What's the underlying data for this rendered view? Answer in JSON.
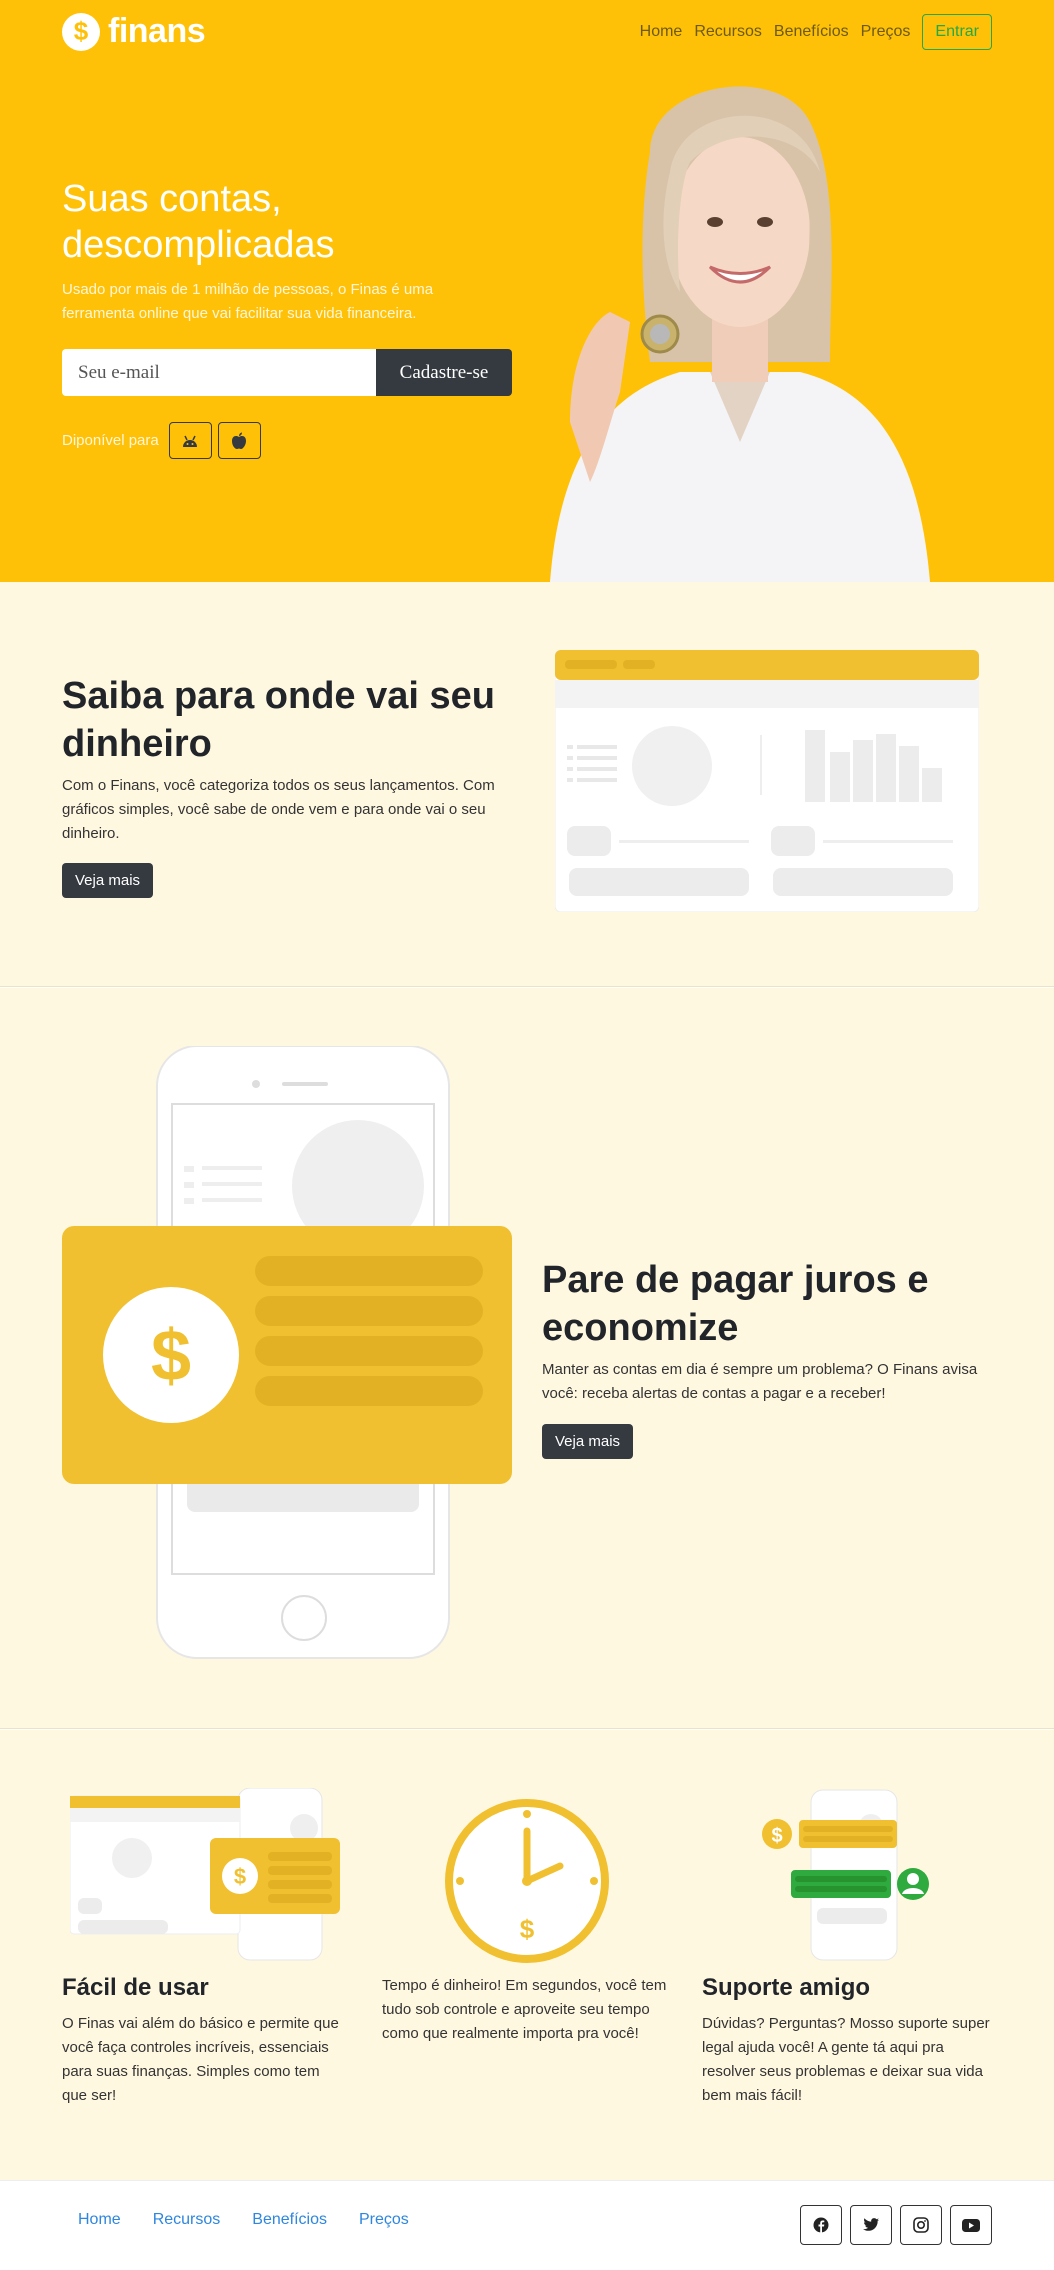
{
  "brand": {
    "name": "finans",
    "logo_symbol": "$",
    "color": "#ffc107"
  },
  "nav": {
    "items": [
      "Home",
      "Recursos",
      "Benefícios",
      "Preços"
    ],
    "login_label": "Entrar"
  },
  "hero": {
    "title": "Suas contas, descomplicadas",
    "subtitle": "Usado por mais de 1 milhão de pessoas, o Finas é uma ferramenta online que vai facilitar sua vida financeira.",
    "email_placeholder": "Seu e-mail",
    "signup_label": "Cadastre-se",
    "platforms_label": "Diponível para",
    "platforms": [
      "android-icon",
      "apple-icon"
    ]
  },
  "section_money": {
    "title": "Saiba para onde vai seu dinheiro",
    "text": "Com o Finans, você categoriza todos os seus lançamentos. Com gráficos simples, você sabe de onde vem e para onde vai o seu dinheiro.",
    "button": "Veja mais"
  },
  "section_interest": {
    "title": "Pare de pagar juros e economize",
    "text": "Manter as contas em dia é sempre um problema? O Finans avisa você: receba alertas de contas a pagar e a receber!",
    "button": "Veja mais"
  },
  "features": [
    {
      "title": "Fácil de usar",
      "text": "O Finas vai além do básico e permite que você faça controles incríveis, essenciais para suas finanças. Simples como tem que ser!"
    },
    {
      "title": "",
      "text": "Tempo é dinheiro! Em segundos, você tem tudo sob controle e aproveite seu tempo como que realmente importa pra você!"
    },
    {
      "title": "Suporte amigo",
      "text": "Dúvidas? Perguntas? Mosso suporte super legal ajuda você! A gente tá aqui pra resolver seus problemas e deixar sua vida bem mais fácil!"
    }
  ],
  "footer": {
    "links": [
      "Home",
      "Recursos",
      "Benefícios",
      "Preços"
    ],
    "social": [
      "facebook-icon",
      "twitter-icon",
      "instagram-icon",
      "youtube-icon"
    ]
  }
}
